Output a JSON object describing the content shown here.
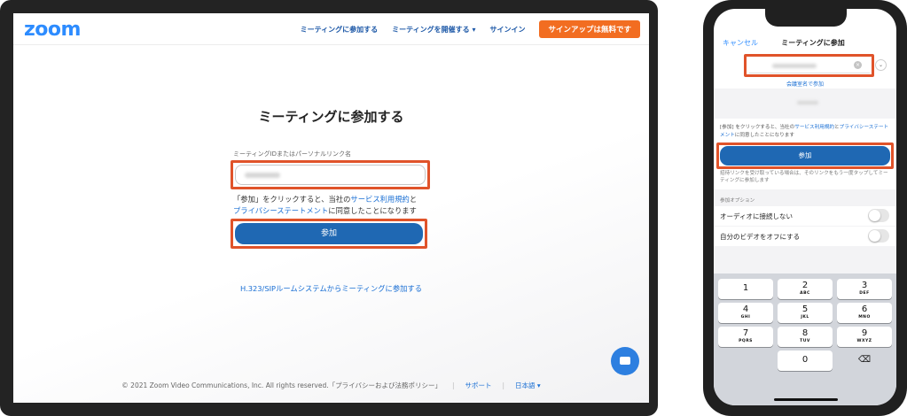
{
  "web": {
    "logo": "zoom",
    "nav": {
      "join": "ミーティングに参加する",
      "host": "ミーティングを開催する ▾",
      "signin": "サインイン",
      "signup": "サインアップは無料です"
    },
    "title": "ミーティングに参加する",
    "field_label": "ミーティングIDまたはパーソナルリンク名",
    "terms_prefix": "「参加」をクリックすると、当社の",
    "terms_link1": "サービス利用規約",
    "terms_and": "と",
    "terms_link2": "プライバシーステートメント",
    "terms_suffix": "に同意したことになります",
    "join_button": "参加",
    "sip_link": "H.323/SIPルームシステムからミーティングに参加する",
    "footer": {
      "copyright": "© 2021 Zoom Video Communications, Inc. All rights reserved.「プライバシーおよび法務ポリシー」",
      "support": "サポート",
      "language": "日本語 ▾"
    }
  },
  "phone": {
    "cancel": "キャンセル",
    "title": "ミーティングに参加",
    "clear": "×",
    "dropdown": "⌄",
    "join_by_name": "会議室名で参加",
    "terms_prefix": "[参加] をクリックすると、当社の",
    "terms_link1": "サービス利用規約",
    "terms_and": "と",
    "terms_link2": "プライバシーステートメント",
    "terms_suffix": "に同意したことになります",
    "join_button": "参加",
    "invite_note": "招待リンクを受け取っている場合は、そのリンクをもう一度タップしてミーティングに参加します",
    "options_label": "参加オプション",
    "option_audio": "オーディオに接続しない",
    "option_video": "自分のビデオをオフにする",
    "keypad": [
      {
        "num": "1",
        "letters": ""
      },
      {
        "num": "2",
        "letters": "ABC"
      },
      {
        "num": "3",
        "letters": "DEF"
      },
      {
        "num": "4",
        "letters": "GHI"
      },
      {
        "num": "5",
        "letters": "JKL"
      },
      {
        "num": "6",
        "letters": "MNO"
      },
      {
        "num": "7",
        "letters": "PQRS"
      },
      {
        "num": "8",
        "letters": "TUV"
      },
      {
        "num": "9",
        "letters": "WXYZ"
      },
      {
        "num": "0",
        "letters": ""
      },
      {
        "num": "⌫",
        "letters": ""
      }
    ]
  },
  "colors": {
    "brand_blue": "#2d8cff",
    "join_blue": "#1f68b3",
    "signup_orange": "#f26d21",
    "highlight_red": "#e0532a"
  }
}
